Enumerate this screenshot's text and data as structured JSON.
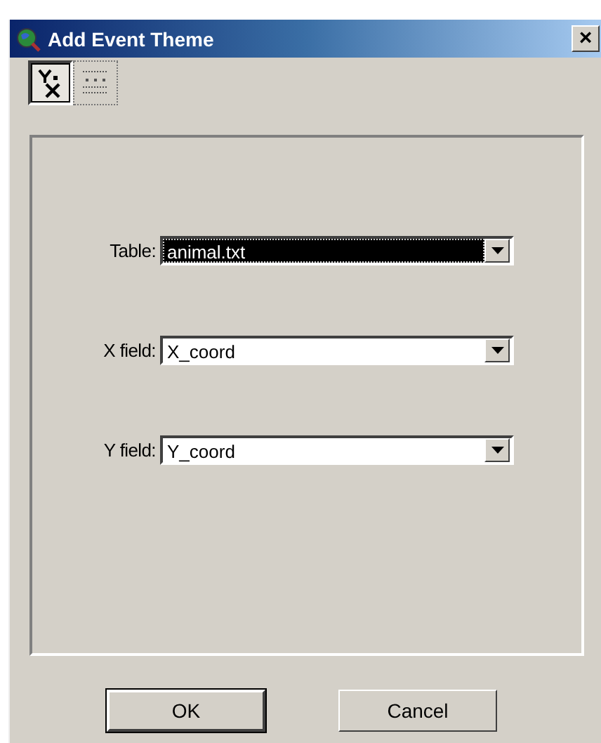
{
  "window": {
    "title": "Add Event Theme",
    "close": "×"
  },
  "tool_buttons": [
    {
      "kind": "xy",
      "selected": true
    },
    {
      "kind": "table",
      "selected": false
    }
  ],
  "fields": [
    {
      "label": "Table:",
      "value": "animal.txt",
      "focused": true
    },
    {
      "label": "X field:",
      "value": "X_coord",
      "focused": false
    },
    {
      "label": "Y field:",
      "value": "Y_coord",
      "focused": false
    }
  ],
  "buttons": [
    {
      "label": "OK",
      "default": true
    },
    {
      "label": "Cancel",
      "default": false
    }
  ]
}
